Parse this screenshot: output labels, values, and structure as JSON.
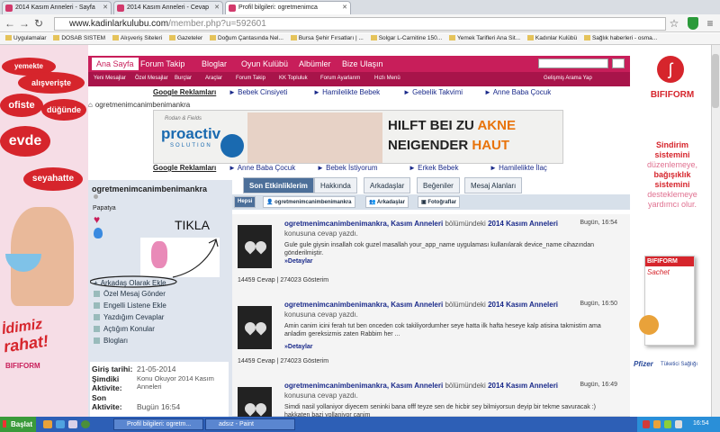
{
  "tabs": [
    {
      "label": "2014 Kasım Anneleri - Sayfa"
    },
    {
      "label": "2014 Kasım Anneleri - Cevap"
    },
    {
      "label": "Profil bilgileri: ogretmenimca"
    }
  ],
  "address": {
    "prefix": "www.kadinlarkulubu.com",
    "path": "/member.php?u=592601"
  },
  "bookmarks": [
    "Uygulamalar",
    "DOSAB SISTEM",
    "Alışveriş Siteleri",
    "Gazeteler",
    "Doğum Çantasında Nel...",
    "Bursa Şehir Fırsatları | ...",
    "Solgar L-Carnitine 150...",
    "Yemek Tarifleri Ana Sit...",
    "Kadınlar Kulübü",
    "Sağlık haberleri - osma..."
  ],
  "nav": [
    "Ana Sayfa",
    "Forum Takip",
    "Bloglar",
    "Oyun Kulübü",
    "Albümler",
    "Bize Ulaşın"
  ],
  "subnav": [
    "Yeni Mesajlar",
    "Özel Mesajlar",
    "Burçlar",
    "Araçlar",
    "Forum Takip",
    "KK Topluluk",
    "Forum Ayarlarım",
    "Hızlı Menü"
  ],
  "advanced_search": "Gelişmiş Arama Yap",
  "links1": [
    "Google Reklamları",
    "Bebek Cinsiyeti",
    "Hamilelikte Bebek",
    "Gebelik Takvimi",
    "Anne Baba Çocuk"
  ],
  "breadcrumb": "ogretmenimcanimbenimankra",
  "banner": {
    "brand": "proactiv",
    "brand_sub": "SOLUTION",
    "ad_text": "HILFT BEI ZU",
    "ad_text2": "NEIGENDER",
    "highlight": "AKNE",
    "highlight2": "HAUT",
    "tag": "Rodan & Fields"
  },
  "links2": [
    "Google Reklamları",
    "Anne Baba Çocuk",
    "Bebek İstiyorum",
    "Erkek Bebek",
    "Hamilelikte İlaç"
  ],
  "profile": {
    "username": "ogretmenimcanimbenimankra",
    "badge": "Papatya",
    "annotation": "TIKLA",
    "actions": [
      "Arkadaş Olarak Ekle",
      "Özel Mesaj Gönder",
      "Engelli Listene Ekle",
      "Yazdığım Cevaplar",
      "Açtığım Konular",
      "Blogları"
    ],
    "info": [
      {
        "k": "Giriş tarihi:",
        "v": "21-05-2014"
      },
      {
        "k": "Şimdiki Aktivite:",
        "v": "Konu Okuyor 2014 Kasım Anneleri"
      },
      {
        "k": "Son Aktivite:",
        "v": "Bugün 16:54"
      }
    ]
  },
  "profile_tabs": [
    "Son Etkinliklerim",
    "Hakkında",
    "Arkadaşlar",
    "Beğeniler",
    "Mesaj Alanları"
  ],
  "filters": [
    "Hepsi",
    "ogretmenimcanimbenimankra",
    "Arkadaşlar",
    "Fotoğraflar"
  ],
  "activities": [
    {
      "user": "ogretmenimcanimbenimankra",
      "thread": "Kasım Anneleri",
      "mid": "bölümündeki",
      "topic": "2014 Kasım Anneleri",
      "time": "Bugün, 16:54",
      "sub": "konusuna cevap yazdı.",
      "body": "Gule gule giysin insallah cok guzel masallah your_app_name uygulaması kullanılarak device_name cihazından gönderilmiştir.",
      "det": "»Detaylar",
      "stats": "14459 Cevap | 274023 Gösterim"
    },
    {
      "user": "ogretmenimcanimbenimankra",
      "thread": "Kasım Anneleri",
      "mid": "bölümündeki",
      "topic": "2014 Kasım Anneleri",
      "time": "Bugün, 16:50",
      "sub": "konusuna cevap yazdı.",
      "body": "Amin canim icini ferah tut ben onceden cok takiliyordumher seye hatta ilk hafta heseye kalp atisina takmistim ama anladim gereksizmis zaten Rabbim her ...",
      "det": "»Detaylar",
      "stats": "14459 Cevap | 274023 Gösterim"
    },
    {
      "user": "ogretmenimcanimbenimankra",
      "thread": "Kasım Anneleri",
      "mid": "bölümündeki",
      "topic": "2014 Kasım Anneleri",
      "time": "Bugün, 16:49",
      "sub": "konusuna cevap yazdı.",
      "body": "Simdi nasil yollaniyor diyecem seninki bana offf teyze sen de hicbir sey bilmiyorsun deyip bir tekme savuracak :) hakkaten bazi yollaniyor canim",
      "det": "",
      "stats": ""
    }
  ],
  "left_ad": {
    "words": [
      "yemekte",
      "alışverişte",
      "ofiste",
      "düğünde",
      "evde",
      "seyahatte"
    ],
    "bottom": "rahat!",
    "bottom2": "İdimiz",
    "brand": "BIFIFORM"
  },
  "right_ad": {
    "brand": "BIFIFORM",
    "line1": "Sindirim",
    "line2": "sistemini",
    "line3": "düzenlemeye,",
    "line4": "bağışıklık",
    "line5": "sistemini",
    "line6": "desteklemeye",
    "line7": "yardımcı olur.",
    "product": "BIFIFORM",
    "product_sub": "Sachet",
    "foot": "Tüketici Sağlığı"
  },
  "taskbar": {
    "start": "Başlat",
    "buttons": [
      "Profil bilgileri: ogretm...",
      "adsız - Paint"
    ],
    "clock": "16:54"
  }
}
